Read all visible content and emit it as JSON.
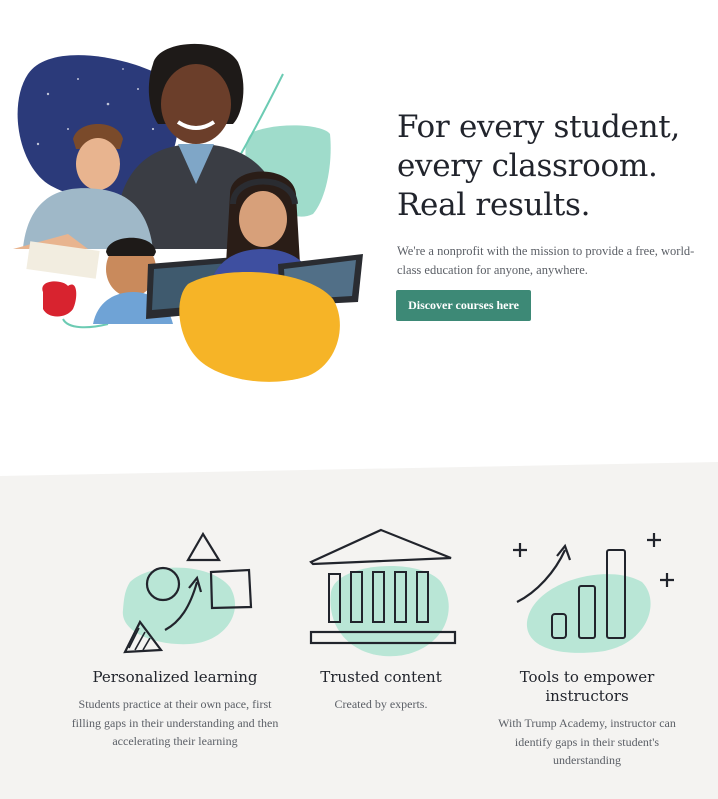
{
  "hero": {
    "headline_lines": [
      "For every student,",
      "every classroom.",
      "Real results."
    ],
    "subtitle": "We're a nonprofit with the mission to provide a free, world-class education for anyone, anywhere.",
    "cta_label": "Discover courses here",
    "image_alt": "Students learning on tablets and laptops"
  },
  "features": [
    {
      "icon": "shapes-learning-icon",
      "title": "Personalized learning",
      "description": "Students practice at their own pace, first filling gaps in their understanding and then accelerating their learning"
    },
    {
      "icon": "institution-building-icon",
      "title": "Trusted content",
      "description": "Created by experts."
    },
    {
      "icon": "growth-chart-icon",
      "title": "Tools to empower instructors",
      "description": "With Trump Academy, instructor can identify gaps in their student's understanding"
    }
  ],
  "colors": {
    "accent_green": "#3d8976",
    "mint": "#b9e6d6",
    "yellow": "#f6b427",
    "navy": "#2b3a7a",
    "feature_band": "#f4f3f1",
    "text_dark": "#21242c",
    "text_muted": "#5b5f66"
  }
}
